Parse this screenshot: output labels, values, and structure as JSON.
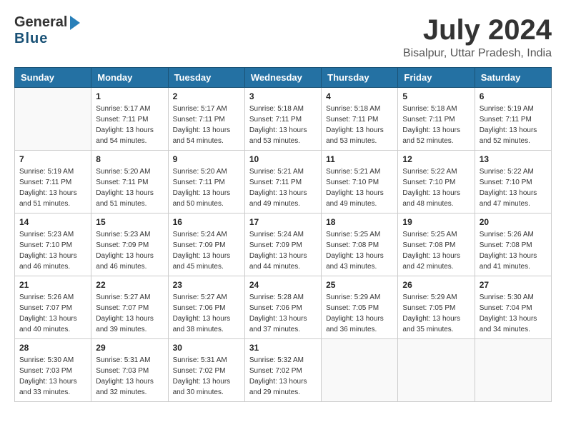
{
  "logo": {
    "general": "General",
    "blue": "Blue"
  },
  "title": {
    "month_year": "July 2024",
    "location": "Bisalpur, Uttar Pradesh, India"
  },
  "headers": [
    "Sunday",
    "Monday",
    "Tuesday",
    "Wednesday",
    "Thursday",
    "Friday",
    "Saturday"
  ],
  "weeks": [
    [
      {
        "day": "",
        "sunrise": "",
        "sunset": "",
        "daylight": ""
      },
      {
        "day": "1",
        "sunrise": "Sunrise: 5:17 AM",
        "sunset": "Sunset: 7:11 PM",
        "daylight": "Daylight: 13 hours and 54 minutes."
      },
      {
        "day": "2",
        "sunrise": "Sunrise: 5:17 AM",
        "sunset": "Sunset: 7:11 PM",
        "daylight": "Daylight: 13 hours and 54 minutes."
      },
      {
        "day": "3",
        "sunrise": "Sunrise: 5:18 AM",
        "sunset": "Sunset: 7:11 PM",
        "daylight": "Daylight: 13 hours and 53 minutes."
      },
      {
        "day": "4",
        "sunrise": "Sunrise: 5:18 AM",
        "sunset": "Sunset: 7:11 PM",
        "daylight": "Daylight: 13 hours and 53 minutes."
      },
      {
        "day": "5",
        "sunrise": "Sunrise: 5:18 AM",
        "sunset": "Sunset: 7:11 PM",
        "daylight": "Daylight: 13 hours and 52 minutes."
      },
      {
        "day": "6",
        "sunrise": "Sunrise: 5:19 AM",
        "sunset": "Sunset: 7:11 PM",
        "daylight": "Daylight: 13 hours and 52 minutes."
      }
    ],
    [
      {
        "day": "7",
        "sunrise": "Sunrise: 5:19 AM",
        "sunset": "Sunset: 7:11 PM",
        "daylight": "Daylight: 13 hours and 51 minutes."
      },
      {
        "day": "8",
        "sunrise": "Sunrise: 5:20 AM",
        "sunset": "Sunset: 7:11 PM",
        "daylight": "Daylight: 13 hours and 51 minutes."
      },
      {
        "day": "9",
        "sunrise": "Sunrise: 5:20 AM",
        "sunset": "Sunset: 7:11 PM",
        "daylight": "Daylight: 13 hours and 50 minutes."
      },
      {
        "day": "10",
        "sunrise": "Sunrise: 5:21 AM",
        "sunset": "Sunset: 7:11 PM",
        "daylight": "Daylight: 13 hours and 49 minutes."
      },
      {
        "day": "11",
        "sunrise": "Sunrise: 5:21 AM",
        "sunset": "Sunset: 7:10 PM",
        "daylight": "Daylight: 13 hours and 49 minutes."
      },
      {
        "day": "12",
        "sunrise": "Sunrise: 5:22 AM",
        "sunset": "Sunset: 7:10 PM",
        "daylight": "Daylight: 13 hours and 48 minutes."
      },
      {
        "day": "13",
        "sunrise": "Sunrise: 5:22 AM",
        "sunset": "Sunset: 7:10 PM",
        "daylight": "Daylight: 13 hours and 47 minutes."
      }
    ],
    [
      {
        "day": "14",
        "sunrise": "Sunrise: 5:23 AM",
        "sunset": "Sunset: 7:10 PM",
        "daylight": "Daylight: 13 hours and 46 minutes."
      },
      {
        "day": "15",
        "sunrise": "Sunrise: 5:23 AM",
        "sunset": "Sunset: 7:09 PM",
        "daylight": "Daylight: 13 hours and 46 minutes."
      },
      {
        "day": "16",
        "sunrise": "Sunrise: 5:24 AM",
        "sunset": "Sunset: 7:09 PM",
        "daylight": "Daylight: 13 hours and 45 minutes."
      },
      {
        "day": "17",
        "sunrise": "Sunrise: 5:24 AM",
        "sunset": "Sunset: 7:09 PM",
        "daylight": "Daylight: 13 hours and 44 minutes."
      },
      {
        "day": "18",
        "sunrise": "Sunrise: 5:25 AM",
        "sunset": "Sunset: 7:08 PM",
        "daylight": "Daylight: 13 hours and 43 minutes."
      },
      {
        "day": "19",
        "sunrise": "Sunrise: 5:25 AM",
        "sunset": "Sunset: 7:08 PM",
        "daylight": "Daylight: 13 hours and 42 minutes."
      },
      {
        "day": "20",
        "sunrise": "Sunrise: 5:26 AM",
        "sunset": "Sunset: 7:08 PM",
        "daylight": "Daylight: 13 hours and 41 minutes."
      }
    ],
    [
      {
        "day": "21",
        "sunrise": "Sunrise: 5:26 AM",
        "sunset": "Sunset: 7:07 PM",
        "daylight": "Daylight: 13 hours and 40 minutes."
      },
      {
        "day": "22",
        "sunrise": "Sunrise: 5:27 AM",
        "sunset": "Sunset: 7:07 PM",
        "daylight": "Daylight: 13 hours and 39 minutes."
      },
      {
        "day": "23",
        "sunrise": "Sunrise: 5:27 AM",
        "sunset": "Sunset: 7:06 PM",
        "daylight": "Daylight: 13 hours and 38 minutes."
      },
      {
        "day": "24",
        "sunrise": "Sunrise: 5:28 AM",
        "sunset": "Sunset: 7:06 PM",
        "daylight": "Daylight: 13 hours and 37 minutes."
      },
      {
        "day": "25",
        "sunrise": "Sunrise: 5:29 AM",
        "sunset": "Sunset: 7:05 PM",
        "daylight": "Daylight: 13 hours and 36 minutes."
      },
      {
        "day": "26",
        "sunrise": "Sunrise: 5:29 AM",
        "sunset": "Sunset: 7:05 PM",
        "daylight": "Daylight: 13 hours and 35 minutes."
      },
      {
        "day": "27",
        "sunrise": "Sunrise: 5:30 AM",
        "sunset": "Sunset: 7:04 PM",
        "daylight": "Daylight: 13 hours and 34 minutes."
      }
    ],
    [
      {
        "day": "28",
        "sunrise": "Sunrise: 5:30 AM",
        "sunset": "Sunset: 7:03 PM",
        "daylight": "Daylight: 13 hours and 33 minutes."
      },
      {
        "day": "29",
        "sunrise": "Sunrise: 5:31 AM",
        "sunset": "Sunset: 7:03 PM",
        "daylight": "Daylight: 13 hours and 32 minutes."
      },
      {
        "day": "30",
        "sunrise": "Sunrise: 5:31 AM",
        "sunset": "Sunset: 7:02 PM",
        "daylight": "Daylight: 13 hours and 30 minutes."
      },
      {
        "day": "31",
        "sunrise": "Sunrise: 5:32 AM",
        "sunset": "Sunset: 7:02 PM",
        "daylight": "Daylight: 13 hours and 29 minutes."
      },
      {
        "day": "",
        "sunrise": "",
        "sunset": "",
        "daylight": ""
      },
      {
        "day": "",
        "sunrise": "",
        "sunset": "",
        "daylight": ""
      },
      {
        "day": "",
        "sunrise": "",
        "sunset": "",
        "daylight": ""
      }
    ]
  ]
}
